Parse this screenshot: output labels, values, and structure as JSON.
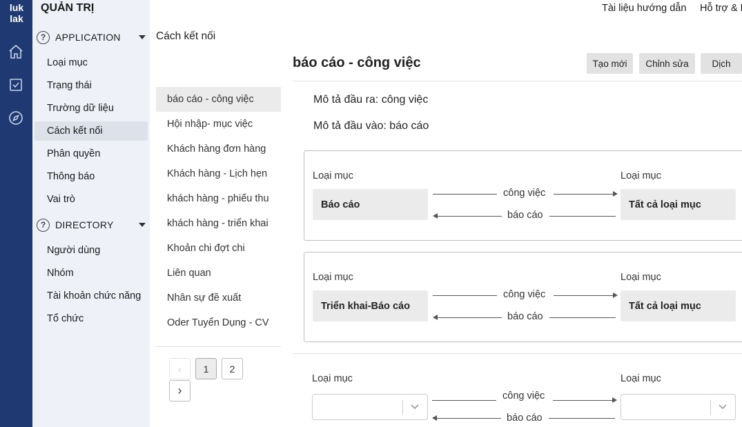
{
  "rail": {
    "logo_line1": "luk",
    "logo_line2": "lak",
    "icons": [
      "home-icon",
      "checkbox-icon",
      "compass-icon"
    ]
  },
  "sidebar": {
    "title": "QUẢN TRỊ",
    "groups": [
      {
        "label": "APPLICATION",
        "items": [
          "Loại mục",
          "Trạng thái",
          "Trường dữ liệu",
          "Cách kết nối",
          "Phân quyền",
          "Thông báo",
          "Vai trò"
        ]
      },
      {
        "label": "DIRECTORY",
        "items": [
          "Người dùng",
          "Nhóm",
          "Tài khoản chức năng",
          "Tổ chức"
        ]
      }
    ],
    "active_item": "Cách kết nối"
  },
  "top_links": [
    "Tài liệu hướng dẫn",
    "Hỗ trợ & P"
  ],
  "page_label": "Cách kết nối",
  "list": {
    "items": [
      "báo cáo - công việc",
      "Hội nhập- mục việc",
      "Khách hàng đơn hàng",
      "Khách hàng - Lịch hẹn",
      "khách hàng - phiếu thu",
      "khách hàng - triển khai",
      "Khoản chi đợt chi",
      "Liên quan",
      "Nhân sự đề xuất",
      "Oder Tuyển Dụng - CV"
    ],
    "active_index": 0,
    "pagination": {
      "prev": "‹",
      "pages": [
        "1",
        "2"
      ],
      "current": "1",
      "next": "›"
    }
  },
  "detail": {
    "title": "báo cáo - công việc",
    "buttons": {
      "create": "Tạo mới",
      "edit": "Chỉnh sửa",
      "translate": "Dịch"
    },
    "output_label": "Mô tả đầu ra:",
    "output_value": "công việc",
    "input_label": "Mô tả đầu vào:",
    "input_value": "báo cáo",
    "connections": [
      {
        "left_label": "Loại mục",
        "left_value": "Báo cáo",
        "right_label": "Loại mục",
        "right_value": "Tất cả loại mục",
        "forward": "công việc",
        "backward": "báo cáo"
      },
      {
        "left_label": "Loại mục",
        "left_value": "Triển khai-Báo cáo",
        "right_label": "Loại mục",
        "right_value": "Tất cả loại mục",
        "forward": "công việc",
        "backward": "báo cáo"
      }
    ],
    "new_connection": {
      "left_label": "Loại mục",
      "right_label": "Loại mục",
      "forward": "công việc",
      "backward": "báo cáo",
      "left_value": "",
      "right_value": ""
    }
  }
}
